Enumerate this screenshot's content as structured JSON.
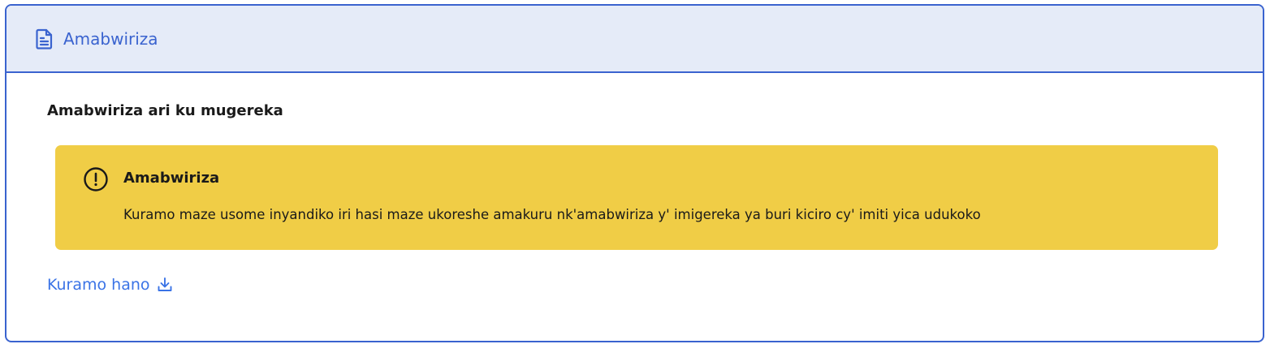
{
  "header": {
    "title": "Amabwiriza",
    "icon": "document-icon"
  },
  "body": {
    "subtitle": "Amabwiriza ari ku mugereka",
    "alert": {
      "icon": "exclamation-circle-icon",
      "title": "Amabwiriza",
      "text": "Kuramo maze usome inyandiko iri hasi maze ukoreshe amakuru nk'amabwiriza y' imigereka ya buri kiciro cy' imiti yica udukoko"
    },
    "download": {
      "label": "Kuramo hano",
      "icon": "download-icon"
    }
  },
  "colors": {
    "accent": "#3a63cf",
    "header_bg": "#e5ebf8",
    "alert_bg": "#f0cd46",
    "link": "#3a73e6"
  }
}
